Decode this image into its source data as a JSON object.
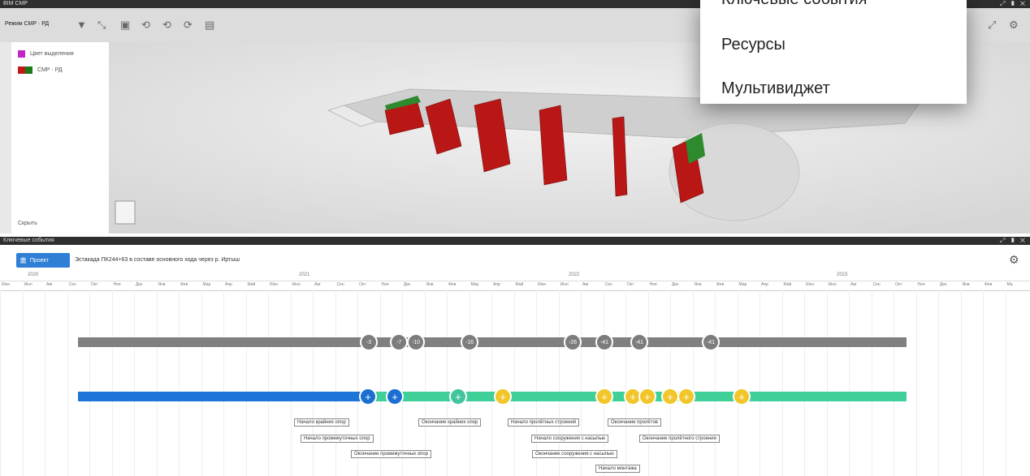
{
  "window1": {
    "title": "BIM СМР",
    "controls": "⤢ ▮ ✕"
  },
  "toolbar": {
    "mode_label": "Режим СМР · РД",
    "icons": [
      "filter-icon",
      "arrows-icon",
      "layers-icon",
      "rotate-icon",
      "rotate2-icon",
      "rotate3-icon",
      "save-icon"
    ]
  },
  "legend": {
    "items": [
      {
        "label": "Цвет выделения",
        "colors": [
          "#c224c8"
        ]
      },
      {
        "label": "СМР · РД",
        "colors": [
          "#c41818",
          "#1a7a1a"
        ]
      }
    ],
    "hide_label": "Скрыть"
  },
  "menu": {
    "items": [
      "Ключевые события",
      "Ресурсы",
      "Мультивиджет"
    ]
  },
  "window2": {
    "title": "Ключевые события",
    "controls": "⤢ ▮ ✕"
  },
  "project": {
    "button_label": "Проект",
    "title": "Эстакада ПК244+63 в составе основного хода через р. Иртыш"
  },
  "timeline": {
    "years": [
      "2020",
      "2021",
      "2022",
      "2023"
    ],
    "months": [
      "Июн",
      "Июл",
      "Авг",
      "Сен",
      "Окт",
      "Ноя",
      "Дек",
      "Янв",
      "Фев",
      "Мар",
      "Апр",
      "Май",
      "Июн",
      "Июл",
      "Авг",
      "Сен",
      "Окт",
      "Ноя",
      "Дек",
      "Янв",
      "Фев",
      "Мар",
      "Апр",
      "Май",
      "Июн",
      "Июл",
      "Авг",
      "Сен",
      "Окт",
      "Ноя",
      "Дек",
      "Янв",
      "Фев",
      "Мар",
      "Апр",
      "Май",
      "Июн",
      "Июл",
      "Авг",
      "Сен",
      "Окт",
      "Ноя",
      "Дек",
      "Янв",
      "Фев",
      "Ма"
    ],
    "gray_events": [
      "-3",
      "-7",
      "-10",
      "-16",
      "-26",
      "-41",
      "-41",
      "-41"
    ],
    "labels": [
      "Начало крайних опор",
      "Начало промежуточных опор",
      "Окончание промежуточных опор",
      "Окончание крайних опор",
      "Начало пролётных строений",
      "Начало сооружения с насыпью",
      "Окончание сооружения с насыпью",
      "Окончание пролётов",
      "Окончание пролётного строения",
      "Начало монтажа"
    ]
  }
}
